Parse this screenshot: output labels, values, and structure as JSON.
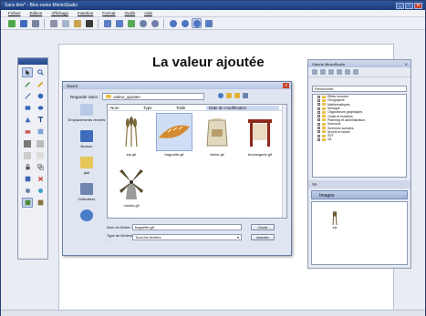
{
  "window": {
    "title": "Sans titre* - Bloc-notes MimioStudio",
    "buttons": [
      "_",
      "▫",
      "✕"
    ]
  },
  "menubar": {
    "items": [
      "Fichier",
      "Edition",
      "Affichage",
      "Insertion",
      "Format",
      "Outils",
      "Aide"
    ]
  },
  "slide": {
    "title": "La valeur ajoutée"
  },
  "dialog": {
    "title": "Ouvrir",
    "look_in_label": "Regarder dans :",
    "look_in_value": "valeur_ajoutee",
    "close": "✕",
    "places": [
      {
        "label": "Emplacements récents",
        "icon": "recent-places-icon"
      },
      {
        "label": "Bureau",
        "icon": "desktop-icon"
      },
      {
        "label": "jadi",
        "icon": "user-folder-icon"
      },
      {
        "label": "Ordinateur",
        "icon": "computer-icon"
      },
      {
        "label": "",
        "icon": "network-icon"
      }
    ],
    "columns": [
      "Nom",
      "Type",
      "Taille",
      "Date de modification"
    ],
    "files": [
      {
        "name": "epi.gif",
        "icon": "wheat-icon"
      },
      {
        "name": "baguette.gif",
        "icon": "baguette-icon"
      },
      {
        "name": "farine.gif",
        "icon": "flour-sack-icon"
      },
      {
        "name": "boulangerie.gif",
        "icon": "bakery-icon"
      },
      {
        "name": "moulin.gif",
        "icon": "windmill-icon"
      }
    ],
    "filename_label": "Nom du fichier :",
    "filename_value": "baguette.gif",
    "filetype_label": "Type de fichiers :",
    "filetype_value": "Tous les fichiers",
    "open_button": "Ouvrir",
    "cancel_button": "Annuler"
  },
  "gallery": {
    "title": "Galerie MimioStudio",
    "search_placeholder": "Rechercher",
    "tree": [
      "Effets sonores",
      "Géographie",
      "Mathématiques",
      "Musique",
      "Organiseurs graphiques",
      "Outils et modèles",
      "Planning et administration",
      "Sciences",
      "Sciences sociales",
      "Sports et loisirs",
      "SVT",
      "VA"
    ],
    "va_label": "VA",
    "images_label": "Images",
    "preview_item": "epi"
  }
}
